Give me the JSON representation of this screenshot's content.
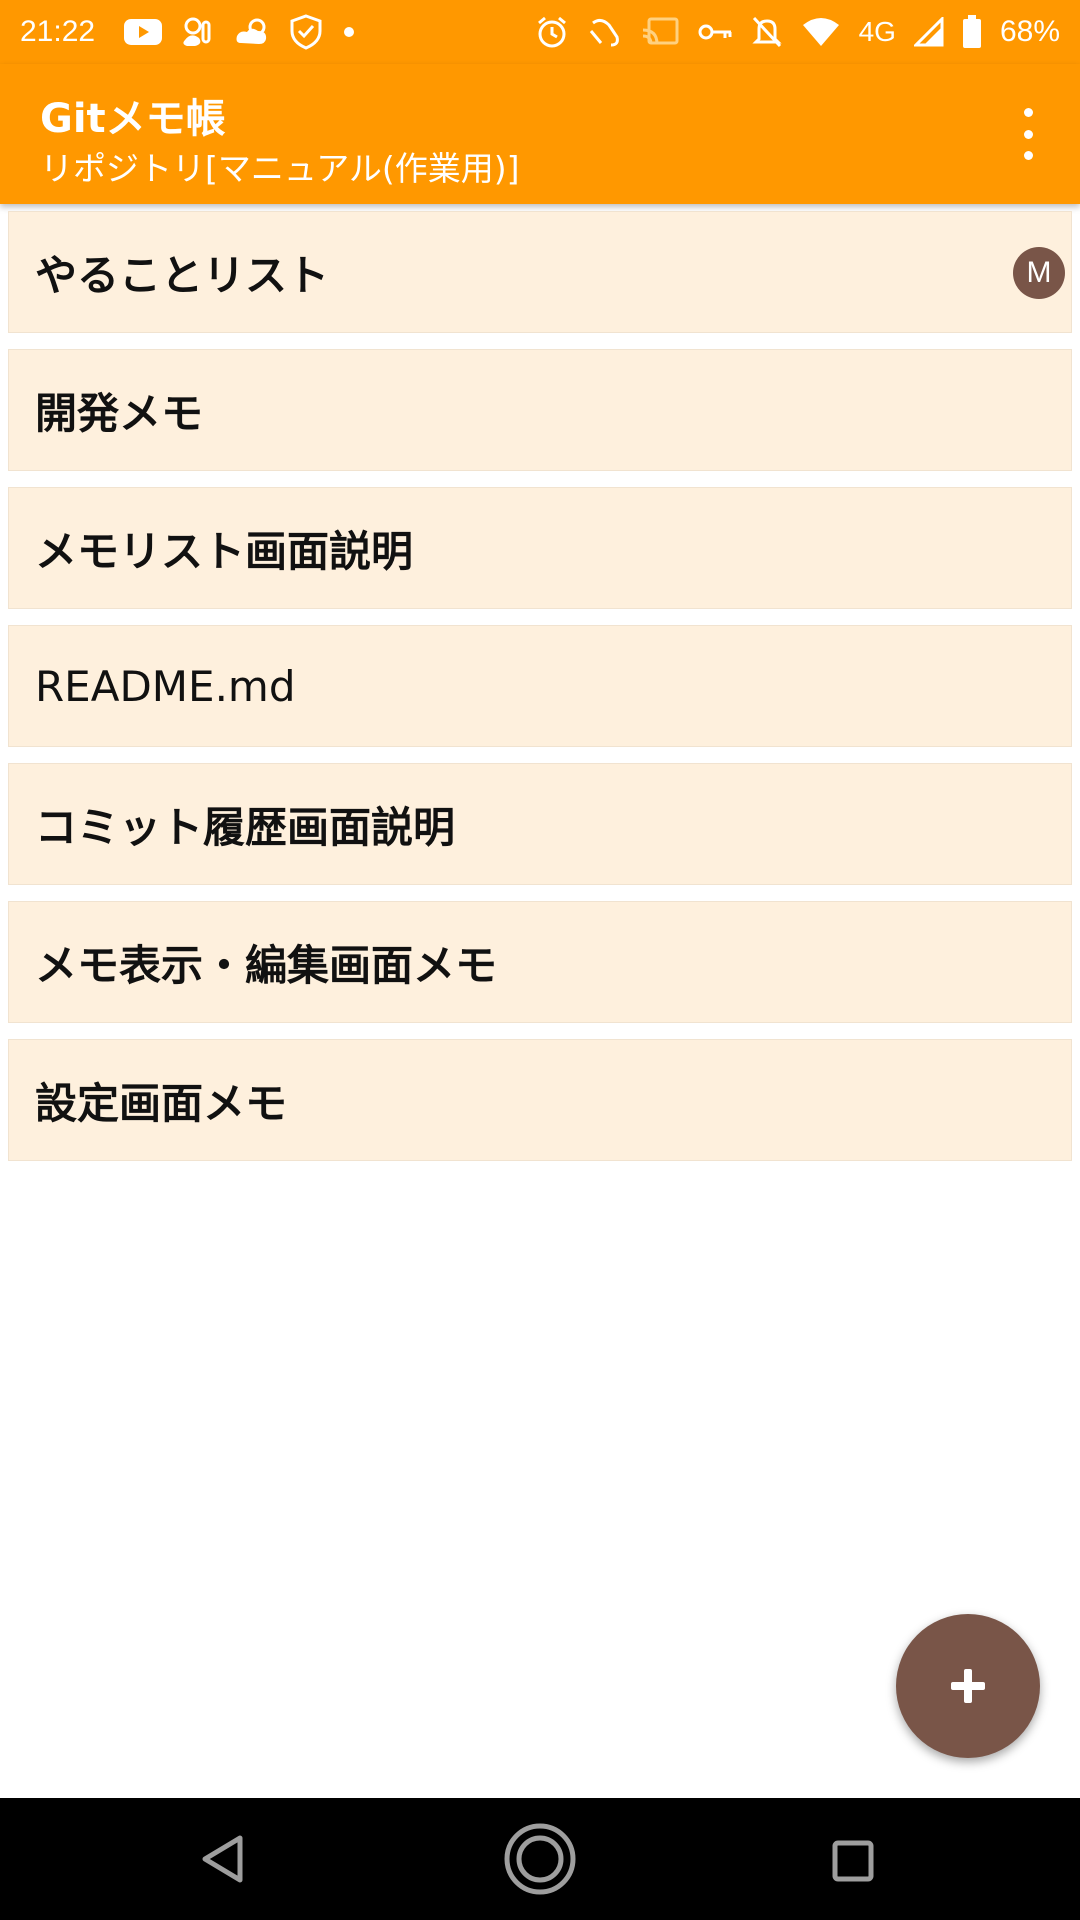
{
  "status_bar": {
    "time": "21:22",
    "network": "4G",
    "battery": "68%",
    "icons_left": [
      "youtube-icon",
      "weather-icon",
      "cloud-icon",
      "shield-icon",
      "dot-icon"
    ],
    "icons_right": [
      "alarm-icon",
      "nfc-icon",
      "cast-icon",
      "key-icon",
      "mute-icon",
      "wifi-icon",
      "signal-icon",
      "battery-icon"
    ]
  },
  "app_bar": {
    "title": "Gitメモ帳",
    "subtitle": "リポジトリ[マニュアル(作業用)]",
    "overflow_icon": "more-vert-icon"
  },
  "memos": [
    {
      "title": "やることリスト",
      "badge": "M"
    },
    {
      "title": "開発メモ"
    },
    {
      "title": "メモリスト画面説明"
    },
    {
      "title": "README.md"
    },
    {
      "title": "コミット履歴画面説明"
    },
    {
      "title": "メモ表示・編集画面メモ"
    },
    {
      "title": "設定画面メモ"
    }
  ],
  "fab": {
    "icon": "plus-icon"
  },
  "nav_bar": {
    "icons": [
      "back-icon",
      "home-icon",
      "recents-icon"
    ]
  },
  "colors": {
    "primary": "#FF9800",
    "accent": "#795548",
    "item_background": "#FEF0DD",
    "nav_background": "#000000"
  }
}
